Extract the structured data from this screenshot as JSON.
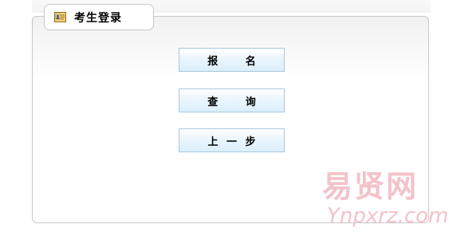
{
  "panel": {
    "title": "考生登录",
    "icon": "id-card-icon"
  },
  "buttons": {
    "signup": "报 名",
    "query": "查 询",
    "previous": "上 一 步"
  },
  "watermark": {
    "chinese": "易贤网",
    "latin": "Ynpxrz.com"
  },
  "colors": {
    "button_border": "#a7c8dd",
    "button_fill": "#dceffb",
    "panel_border": "#c9c9c9",
    "watermark": "#f2c3c9"
  }
}
